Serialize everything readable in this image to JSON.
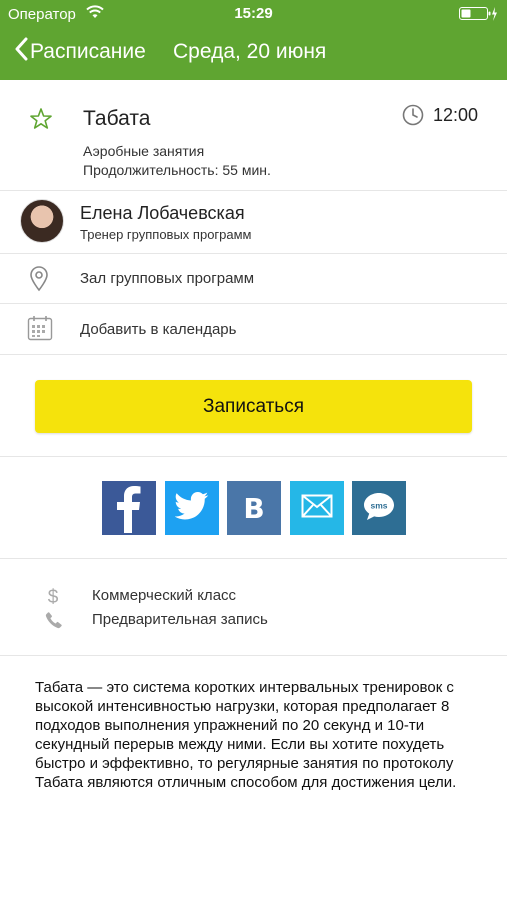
{
  "status_bar": {
    "carrier": "Оператор",
    "time": "15:29",
    "icons": [
      "wifi-icon",
      "battery-charging-icon"
    ]
  },
  "nav": {
    "back_label": "Расписание",
    "title": "Среда, 20 июня",
    "icons": [
      "chevron-left-icon"
    ]
  },
  "class": {
    "title": "Табата",
    "time": "12:00",
    "type": "Аэробные занятия",
    "duration": "Продолжительность: 55 мин.",
    "icons": [
      "star-outline-icon",
      "clock-icon"
    ]
  },
  "trainer": {
    "name": "Елена Лобачевская",
    "role": "Тренер групповых программ"
  },
  "location": {
    "label": "Зал групповых программ",
    "icon": "map-pin-icon"
  },
  "calendar": {
    "label": "Добавить в календарь",
    "icon": "calendar-icon"
  },
  "signup_label": "Записаться",
  "share": {
    "buttons": [
      {
        "name": "facebook",
        "icon": "facebook-icon",
        "color": "#3b5998"
      },
      {
        "name": "twitter",
        "icon": "twitter-icon",
        "color": "#1da1f2"
      },
      {
        "name": "vkontakte",
        "icon": "vk-icon",
        "color": "#4a76a8"
      },
      {
        "name": "email",
        "icon": "mail-icon",
        "color": "#25b7e7"
      },
      {
        "name": "sms",
        "icon": "sms-icon",
        "color": "#2e6e94"
      }
    ]
  },
  "extras": [
    {
      "label": "Коммерческий класс",
      "icon": "dollar-icon"
    },
    {
      "label": "Предварительная запись",
      "icon": "phone-icon"
    }
  ],
  "description": "Табата — это система коротких интервальных тренировок с высокой интенсивностью нагрузки, которая предполагает 8 подходов выполнения упражнений по 20 секунд и 10-ти секундный перерыв между ними. Если вы хотите похудеть быстро и эффективно, то регулярные занятия по протоколу Табата являются отличным способом для достижения цели.",
  "colors": {
    "header_green": "#5fa531",
    "button_yellow": "#f5e30c",
    "star_green": "#5fa531"
  }
}
